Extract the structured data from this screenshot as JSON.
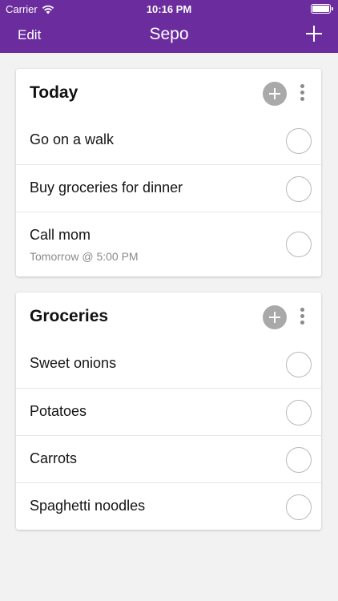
{
  "status_bar": {
    "carrier": "Carrier",
    "time": "10:16 PM"
  },
  "nav": {
    "edit_label": "Edit",
    "title": "Sepo",
    "add_icon": "plus-icon"
  },
  "colors": {
    "accent": "#6b2c9e",
    "background": "#f2f2f2",
    "add_button": "#a9a9a9"
  },
  "lists": [
    {
      "title": "Today",
      "items": [
        {
          "label": "Go on a walk",
          "sub": ""
        },
        {
          "label": "Buy groceries for dinner",
          "sub": ""
        },
        {
          "label": "Call mom",
          "sub": "Tomorrow @ 5:00 PM"
        }
      ]
    },
    {
      "title": "Groceries",
      "items": [
        {
          "label": "Sweet onions",
          "sub": ""
        },
        {
          "label": "Potatoes",
          "sub": ""
        },
        {
          "label": "Carrots",
          "sub": ""
        },
        {
          "label": "Spaghetti noodles",
          "sub": ""
        }
      ]
    }
  ]
}
